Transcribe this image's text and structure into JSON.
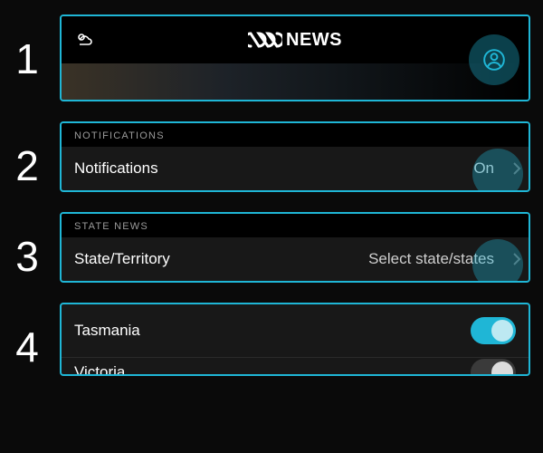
{
  "steps": [
    "1",
    "2",
    "3",
    "4"
  ],
  "header": {
    "brand_text": "NEWS"
  },
  "notifications": {
    "section_label": "NOTIFICATIONS",
    "row_label": "Notifications",
    "value": "On"
  },
  "state_news": {
    "section_label": "STATE NEWS",
    "row_label": "State/Territory",
    "value": "Select state/states"
  },
  "states_list": {
    "items": [
      {
        "label": "Tasmania",
        "on": true
      },
      {
        "label": "Victoria",
        "on": false
      }
    ]
  },
  "colors": {
    "accent": "#1fb6d6"
  }
}
